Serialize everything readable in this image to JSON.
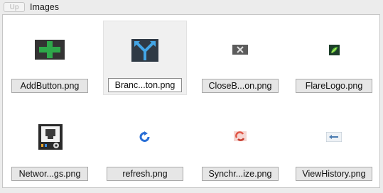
{
  "toolbar": {
    "up_label": "Up",
    "breadcrumb": "Images"
  },
  "items": [
    {
      "name": "AddButton.png",
      "icon": "plus-icon"
    },
    {
      "name": "Branc...ton.png",
      "icon": "branch-icon"
    },
    {
      "name": "CloseB...on.png",
      "icon": "close-icon"
    },
    {
      "name": "FlareLogo.png",
      "icon": "flare-logo-icon"
    },
    {
      "name": "Networ...gs.png",
      "icon": "network-settings-icon"
    },
    {
      "name": "refresh.png",
      "icon": "refresh-icon"
    },
    {
      "name": "Synchr...ize.png",
      "icon": "synchronize-icon"
    },
    {
      "name": "ViewHistory.png",
      "icon": "view-history-icon"
    }
  ],
  "selected_item": "Branc...ton.png",
  "colors": {
    "plus": "#2ea84a",
    "plus_bg": "#333333",
    "branch_bg": "#2f3a45",
    "branch_accent": "#43a6e6",
    "close_bg": "#5c5c5c",
    "flare_green": "#54c13a",
    "refresh_blue": "#2a6fd6",
    "sync_red": "#e05545"
  }
}
